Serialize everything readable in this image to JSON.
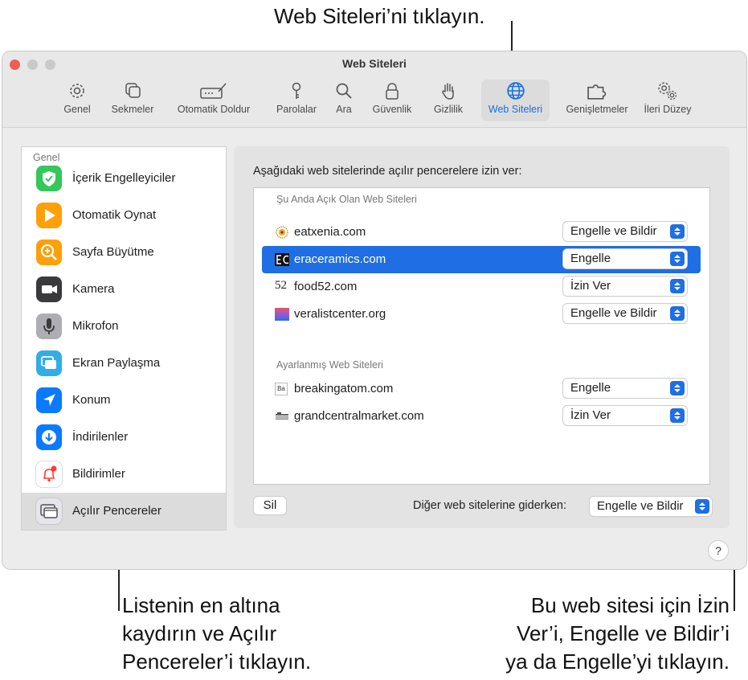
{
  "callouts": {
    "top": "Web Siteleri’ni tıklayın.",
    "left": [
      "Listenin en altına",
      "kaydırın ve Açılır",
      "Pencereler’i tıklayın."
    ],
    "right": [
      "Bu web sitesi için İzin",
      "Ver’i, Engelle ve Bildir’i",
      "ya da Engelle’yi tıklayın."
    ]
  },
  "window": {
    "title": "Web Siteleri",
    "traffic_colors": [
      "#ee5e56",
      "#c9c9c9",
      "#c9c9c9"
    ]
  },
  "toolbar": [
    {
      "label": "Genel",
      "icon": "gear-icon"
    },
    {
      "label": "Sekmeler",
      "icon": "tabs-icon"
    },
    {
      "label": "Otomatik Doldur",
      "icon": "autofill-icon"
    },
    {
      "label": "Parolalar",
      "icon": "key-icon"
    },
    {
      "label": "Ara",
      "icon": "search-icon"
    },
    {
      "label": "Güvenlik",
      "icon": "lock-icon"
    },
    {
      "label": "Gizlilik",
      "icon": "hand-icon"
    },
    {
      "label": "Web Siteleri",
      "icon": "globe-icon",
      "active": true
    },
    {
      "label": "Genişletmeler",
      "icon": "puzzle-icon"
    },
    {
      "label": "İleri Düzey",
      "icon": "gears-icon"
    }
  ],
  "sidebar": {
    "header": "Genel",
    "items": [
      {
        "label": "İçerik Engelleyiciler",
        "icon": "content-blocker-icon",
        "color": "#34c759"
      },
      {
        "label": "Otomatik Oynat",
        "icon": "autoplay-icon",
        "color": "#ff9f0a"
      },
      {
        "label": "Sayfa Büyütme",
        "icon": "page-zoom-icon",
        "color": "#ff9f0a"
      },
      {
        "label": "Kamera",
        "icon": "camera-icon",
        "color": "#3a3a3c"
      },
      {
        "label": "Mikrofon",
        "icon": "microphone-icon",
        "color": "#8e8e93"
      },
      {
        "label": "Ekran Paylaşma",
        "icon": "screen-sharing-icon",
        "color": "#32ade6"
      },
      {
        "label": "Konum",
        "icon": "location-icon",
        "color": "#0a7aff"
      },
      {
        "label": "İndirilenler",
        "icon": "downloads-icon",
        "color": "#0a7aff"
      },
      {
        "label": "Bildirimler",
        "icon": "notifications-icon",
        "color": "#ffffff"
      },
      {
        "label": "Açılır Pencereler",
        "icon": "popup-windows-icon",
        "color": "#e5e5ea",
        "selected": true
      }
    ]
  },
  "main": {
    "heading": "Aşağıdaki web sitelerinde açılır pencerelere izin ver:",
    "open_section": "Şu Anda Açık Olan Web Siteleri",
    "open_sites": [
      {
        "name": "eatxenia.com",
        "setting": "Engelle ve Bildir",
        "favicon": "sun-favicon-icon"
      },
      {
        "name": "eraceramics.com",
        "setting": "Engelle",
        "favicon": "ec-favicon-icon",
        "selected": true
      },
      {
        "name": "food52.com",
        "setting": "İzin Ver",
        "favicon": "52-favicon-icon",
        "favicon_text": "52"
      },
      {
        "name": "veralistcenter.org",
        "setting": "Engelle ve Bildir",
        "favicon": "gradient-favicon-icon"
      }
    ],
    "configured_section": "Ayarlanmış Web Siteleri",
    "configured_sites": [
      {
        "name": "breakingatom.com",
        "setting": "Engelle",
        "favicon": "ba-favicon-icon",
        "favicon_text": "Ba"
      },
      {
        "name": "grandcentralmarket.com",
        "setting": "İzin Ver",
        "favicon": "gcm-favicon-icon"
      }
    ],
    "remove_label": "Sil",
    "other_label": "Diğer web sitelerine giderken:",
    "other_value": "Engelle ve Bildir",
    "help": "?",
    "accent": "#1f6ee3"
  }
}
